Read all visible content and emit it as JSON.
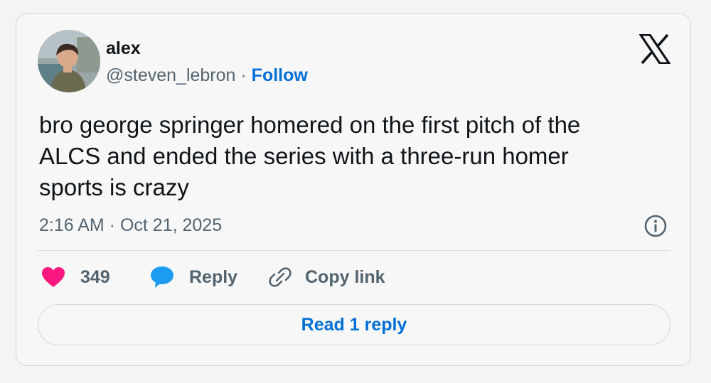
{
  "author": {
    "name": "alex",
    "handle": "@steven_lebron",
    "separator": "·",
    "follow_label": "Follow"
  },
  "tweet": {
    "text": "bro george springer homered on the first pitch of the\nALCS and ended the series with a three-run homer\nsports is crazy",
    "timestamp": "2:16 AM · Oct 21, 2025"
  },
  "actions": {
    "like_count": "349",
    "reply_label": "Reply",
    "copy_link_label": "Copy link"
  },
  "footer": {
    "read_replies_label": "Read 1 reply"
  },
  "icons": {
    "brand": "x-logo-icon",
    "info": "info-icon",
    "like": "heart-icon",
    "reply": "speech-bubble-icon",
    "copy": "link-icon"
  },
  "colors": {
    "link": "#006fd6",
    "heart": "#f91880",
    "reply_bubble": "#1d9bf0",
    "muted_text": "#536471",
    "primary_text": "#0f1419"
  }
}
